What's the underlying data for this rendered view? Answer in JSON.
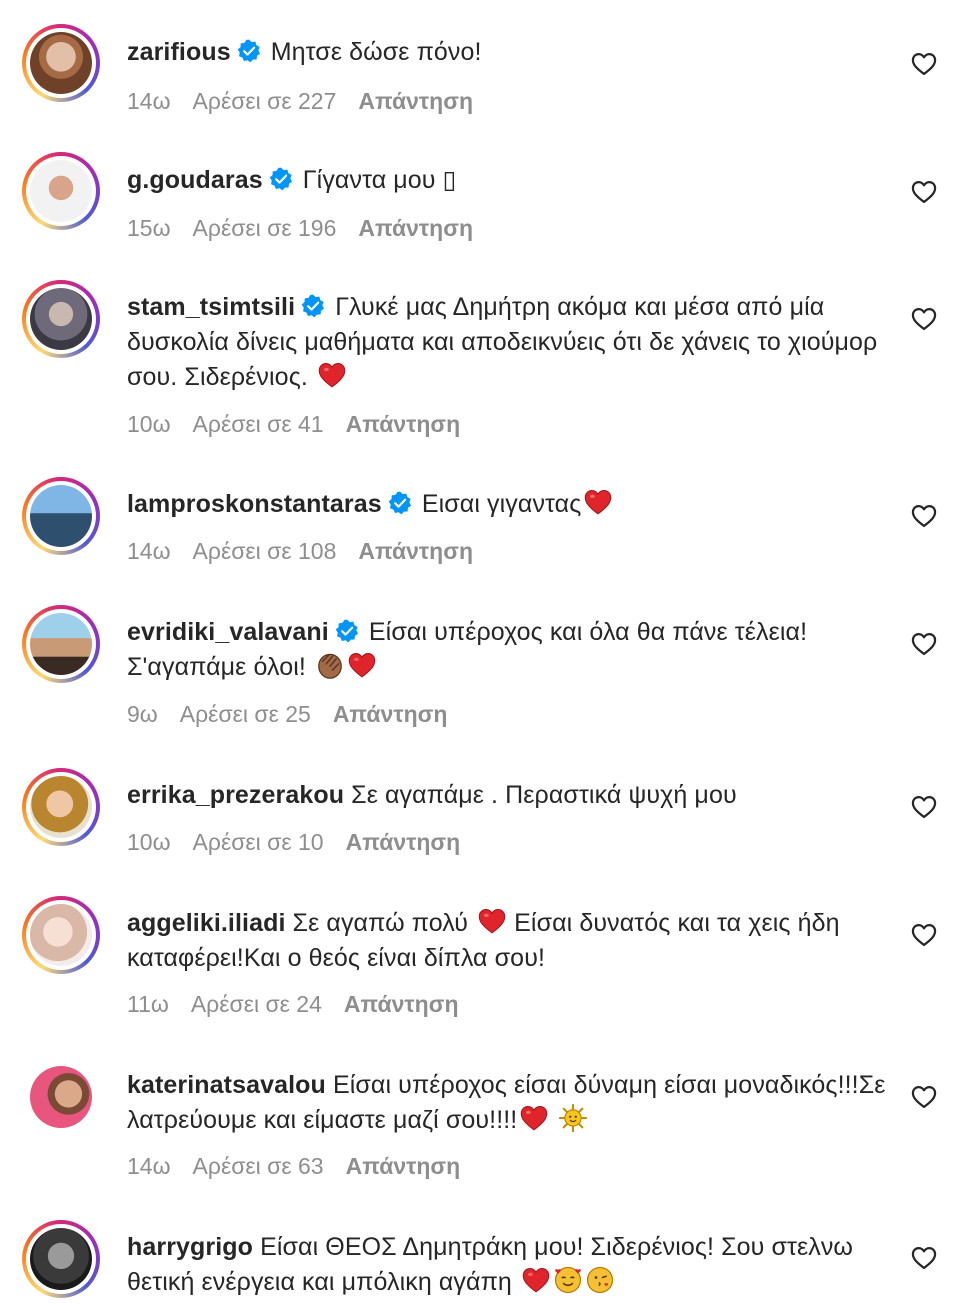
{
  "comments": [
    {
      "username": "zarifious",
      "verified": true,
      "text": "Μητσε δώσε πόνο!",
      "time": "14ω",
      "likes": "Αρέσει σε 227",
      "reply_label": "Απάντηση"
    },
    {
      "username": "g.goudaras",
      "verified": true,
      "text": "Γίγαντα μου ▯",
      "time": "15ω",
      "likes": "Αρέσει σε 196",
      "reply_label": "Απάντηση"
    },
    {
      "username": "stam_tsimtsili",
      "verified": true,
      "text": "Γλυκέ μας Δημήτρη ακόμα και μέσα από μία δυσκολία δίνεις μαθήματα και αποδεικνύεις ότι δε χάνεις το χιούμορ σου. Σιδερένιος.",
      "time": "10ω",
      "likes": "Αρέσει σε 41",
      "reply_label": "Απάντηση"
    },
    {
      "username": "lamproskonstantaras",
      "verified": true,
      "text": "Εισαι γιγαντας",
      "time": "14ω",
      "likes": "Αρέσει σε 108",
      "reply_label": "Απάντηση"
    },
    {
      "username": "evridiki_valavani",
      "verified": true,
      "text": "Είσαι υπέροχος και όλα θα πάνε τέλεια! Σ'αγαπάμε όλοι!",
      "time": "9ω",
      "likes": "Αρέσει σε 25",
      "reply_label": "Απάντηση"
    },
    {
      "username": "errika_prezerakou",
      "verified": false,
      "text": "Σε αγαπάμε . Περαστικά ψυχή μου",
      "time": "10ω",
      "likes": "Αρέσει σε 10",
      "reply_label": "Απάντηση"
    },
    {
      "username": "aggeliki.iliadi",
      "verified": false,
      "text_part1": "Σε αγαπώ πολύ",
      "text_part2": "Είσαι δυνατός και τα χεις ήδη καταφέρει!Και ο θεός είναι δίπλα σου!",
      "time": "11ω",
      "likes": "Αρέσει σε 24",
      "reply_label": "Απάντηση"
    },
    {
      "username": "katerinatsavalou",
      "verified": false,
      "text": "Είσαι υπέροχος είσαι δύναμη είσαι μοναδικός!!!Σε λατρεύουμε και είμαστε μαζί σου!!!!",
      "time": "14ω",
      "likes": "Αρέσει σε 63",
      "reply_label": "Απάντηση"
    },
    {
      "username": "harrygrigo",
      "verified": false,
      "text": "Είσαι ΘΕΟΣ Δημητράκη μου! Σιδερένιος! Σου στελνω θετική ενέργεια και μπόλικη αγάπη",
      "time": "",
      "likes": "",
      "reply_label": ""
    }
  ],
  "colors": {
    "text": "#262626",
    "meta": "#8e8e8e",
    "verified": "#0095f6",
    "heart": "#e0242b"
  },
  "icons": {
    "verified": "verified-badge-icon",
    "like": "heart-outline-icon",
    "heart_emoji": "red-heart-emoji",
    "clap_emoji": "clapping-hands-emoji",
    "sun_emoji": "sun-emoji",
    "love_face_emoji": "smiling-face-with-hearts-emoji",
    "kiss_face_emoji": "face-blowing-kiss-emoji"
  }
}
